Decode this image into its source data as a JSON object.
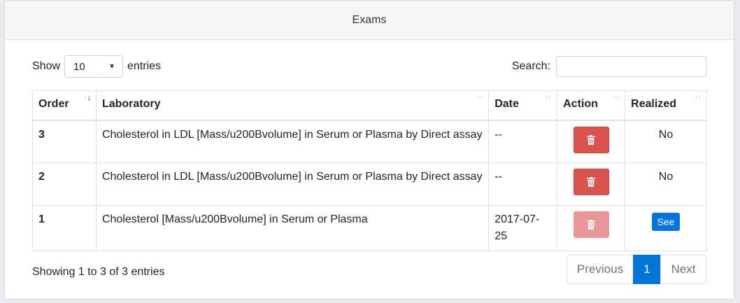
{
  "card": {
    "title": "Exams"
  },
  "controls": {
    "show_label": "Show",
    "entries_label": "entries",
    "length_value": "10",
    "search_label": "Search:",
    "search_value": ""
  },
  "table": {
    "headers": [
      "Order",
      "Laboratory",
      "Date",
      "Action",
      "Realized"
    ],
    "rows": [
      {
        "order": "3",
        "laboratory": "Cholesterol in LDL [Mass/u200Bvolume] in Serum or Plasma by Direct assay",
        "date": "--",
        "realized": "No"
      },
      {
        "order": "2",
        "laboratory": "Cholesterol in LDL [Mass/u200Bvolume] in Serum or Plasma by Direct assay",
        "date": "--",
        "realized": "No"
      },
      {
        "order": "1",
        "laboratory": "Cholesterol [Mass/u200Bvolume] in Serum or Plasma",
        "date": "2017-07-25",
        "realized_button": "See"
      }
    ]
  },
  "footer": {
    "info": "Showing 1 to 3 of 3 entries",
    "previous": "Previous",
    "page": "1",
    "next": "Next"
  },
  "colors": {
    "danger": "#d9534f",
    "danger_disabled": "#e79896",
    "primary": "#0275d8"
  }
}
